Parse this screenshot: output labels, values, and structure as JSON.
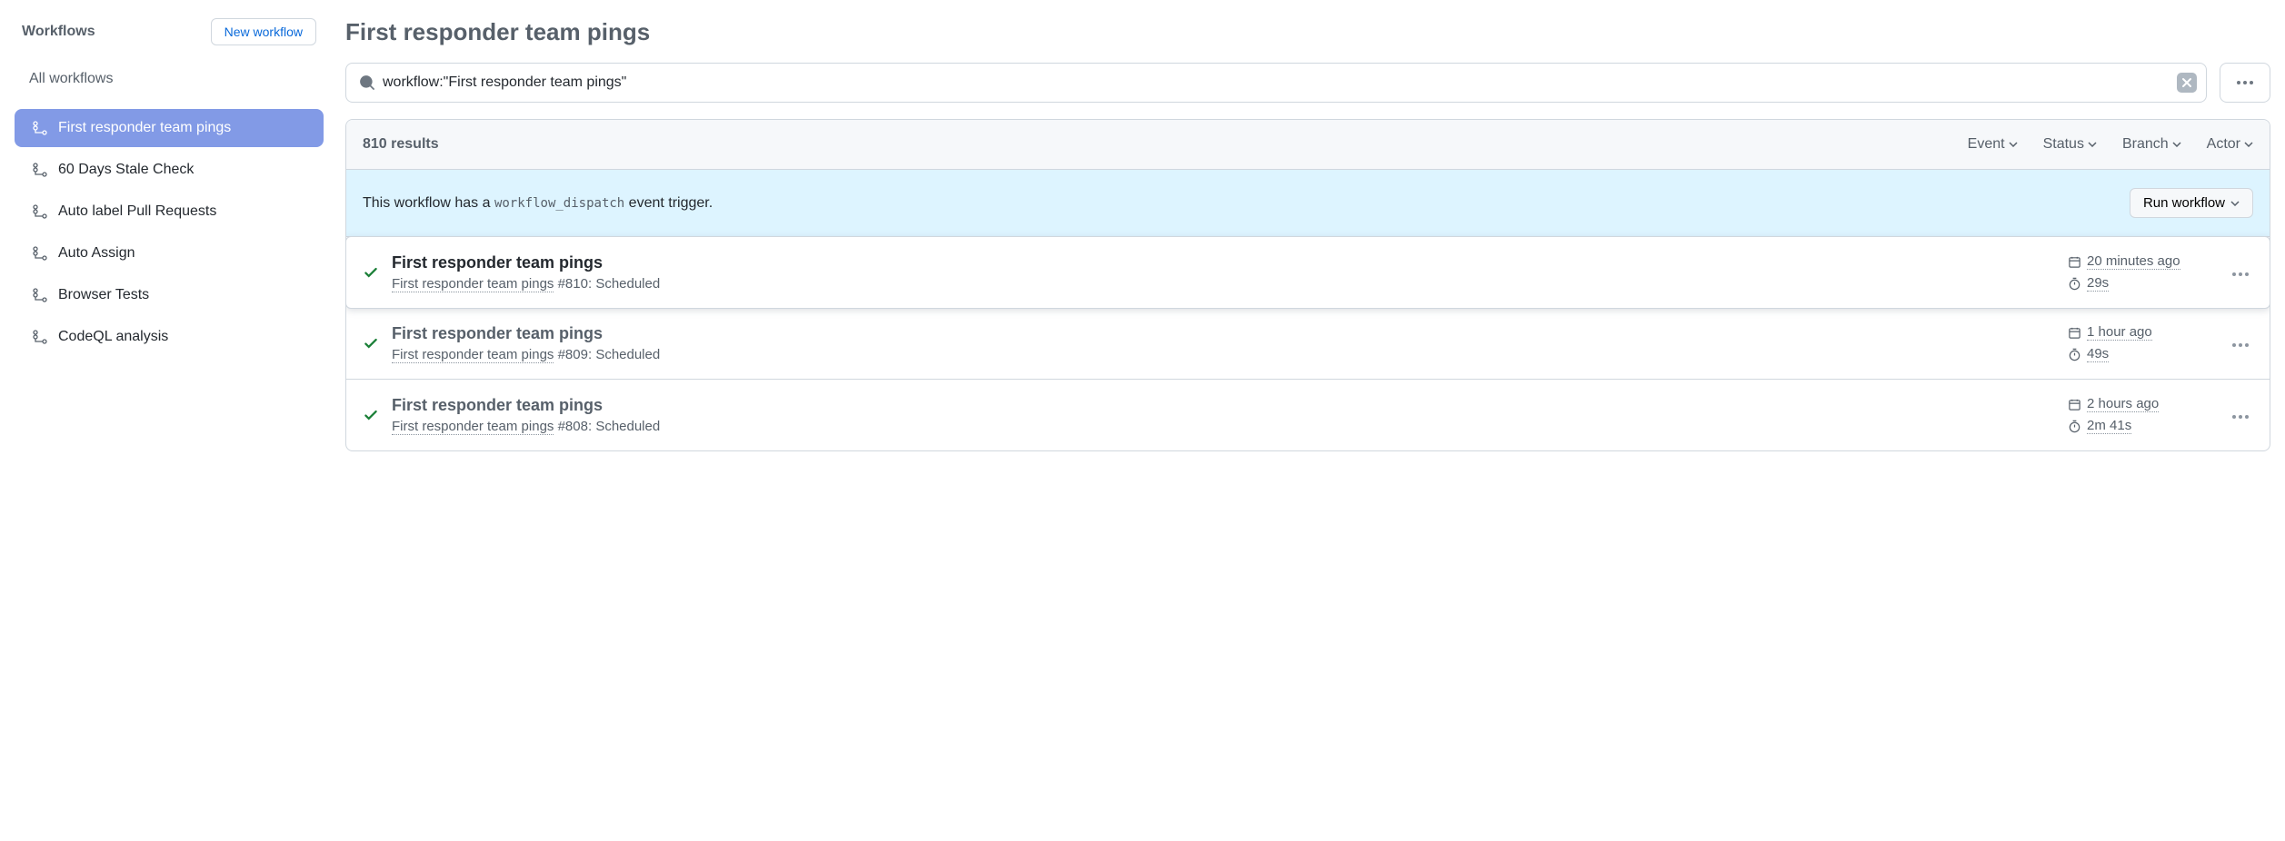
{
  "sidebar": {
    "title": "Workflows",
    "new_btn": "New workflow",
    "all_label": "All workflows",
    "items": [
      {
        "label": "First responder team pings"
      },
      {
        "label": "60 Days Stale Check"
      },
      {
        "label": "Auto label Pull Requests"
      },
      {
        "label": "Auto Assign"
      },
      {
        "label": "Browser Tests"
      },
      {
        "label": "CodeQL analysis"
      }
    ]
  },
  "page_title": "First responder team pings",
  "search": {
    "value": "workflow:\"First responder team pings\""
  },
  "results": {
    "count_text": "810 results"
  },
  "filters": {
    "event": "Event",
    "status": "Status",
    "branch": "Branch",
    "actor": "Actor"
  },
  "dispatch": {
    "prefix": "This workflow has a ",
    "code": "workflow_dispatch",
    "suffix": " event trigger.",
    "run_btn": "Run workflow"
  },
  "runs": [
    {
      "title": "First responder team pings",
      "workflow": "First responder team pings",
      "run_id": "#810",
      "trigger": "Scheduled",
      "time": "20 minutes ago",
      "duration": "29s"
    },
    {
      "title": "First responder team pings",
      "workflow": "First responder team pings",
      "run_id": "#809",
      "trigger": "Scheduled",
      "time": "1 hour ago",
      "duration": "49s"
    },
    {
      "title": "First responder team pings",
      "workflow": "First responder team pings",
      "run_id": "#808",
      "trigger": "Scheduled",
      "time": "2 hours ago",
      "duration": "2m 41s"
    }
  ]
}
